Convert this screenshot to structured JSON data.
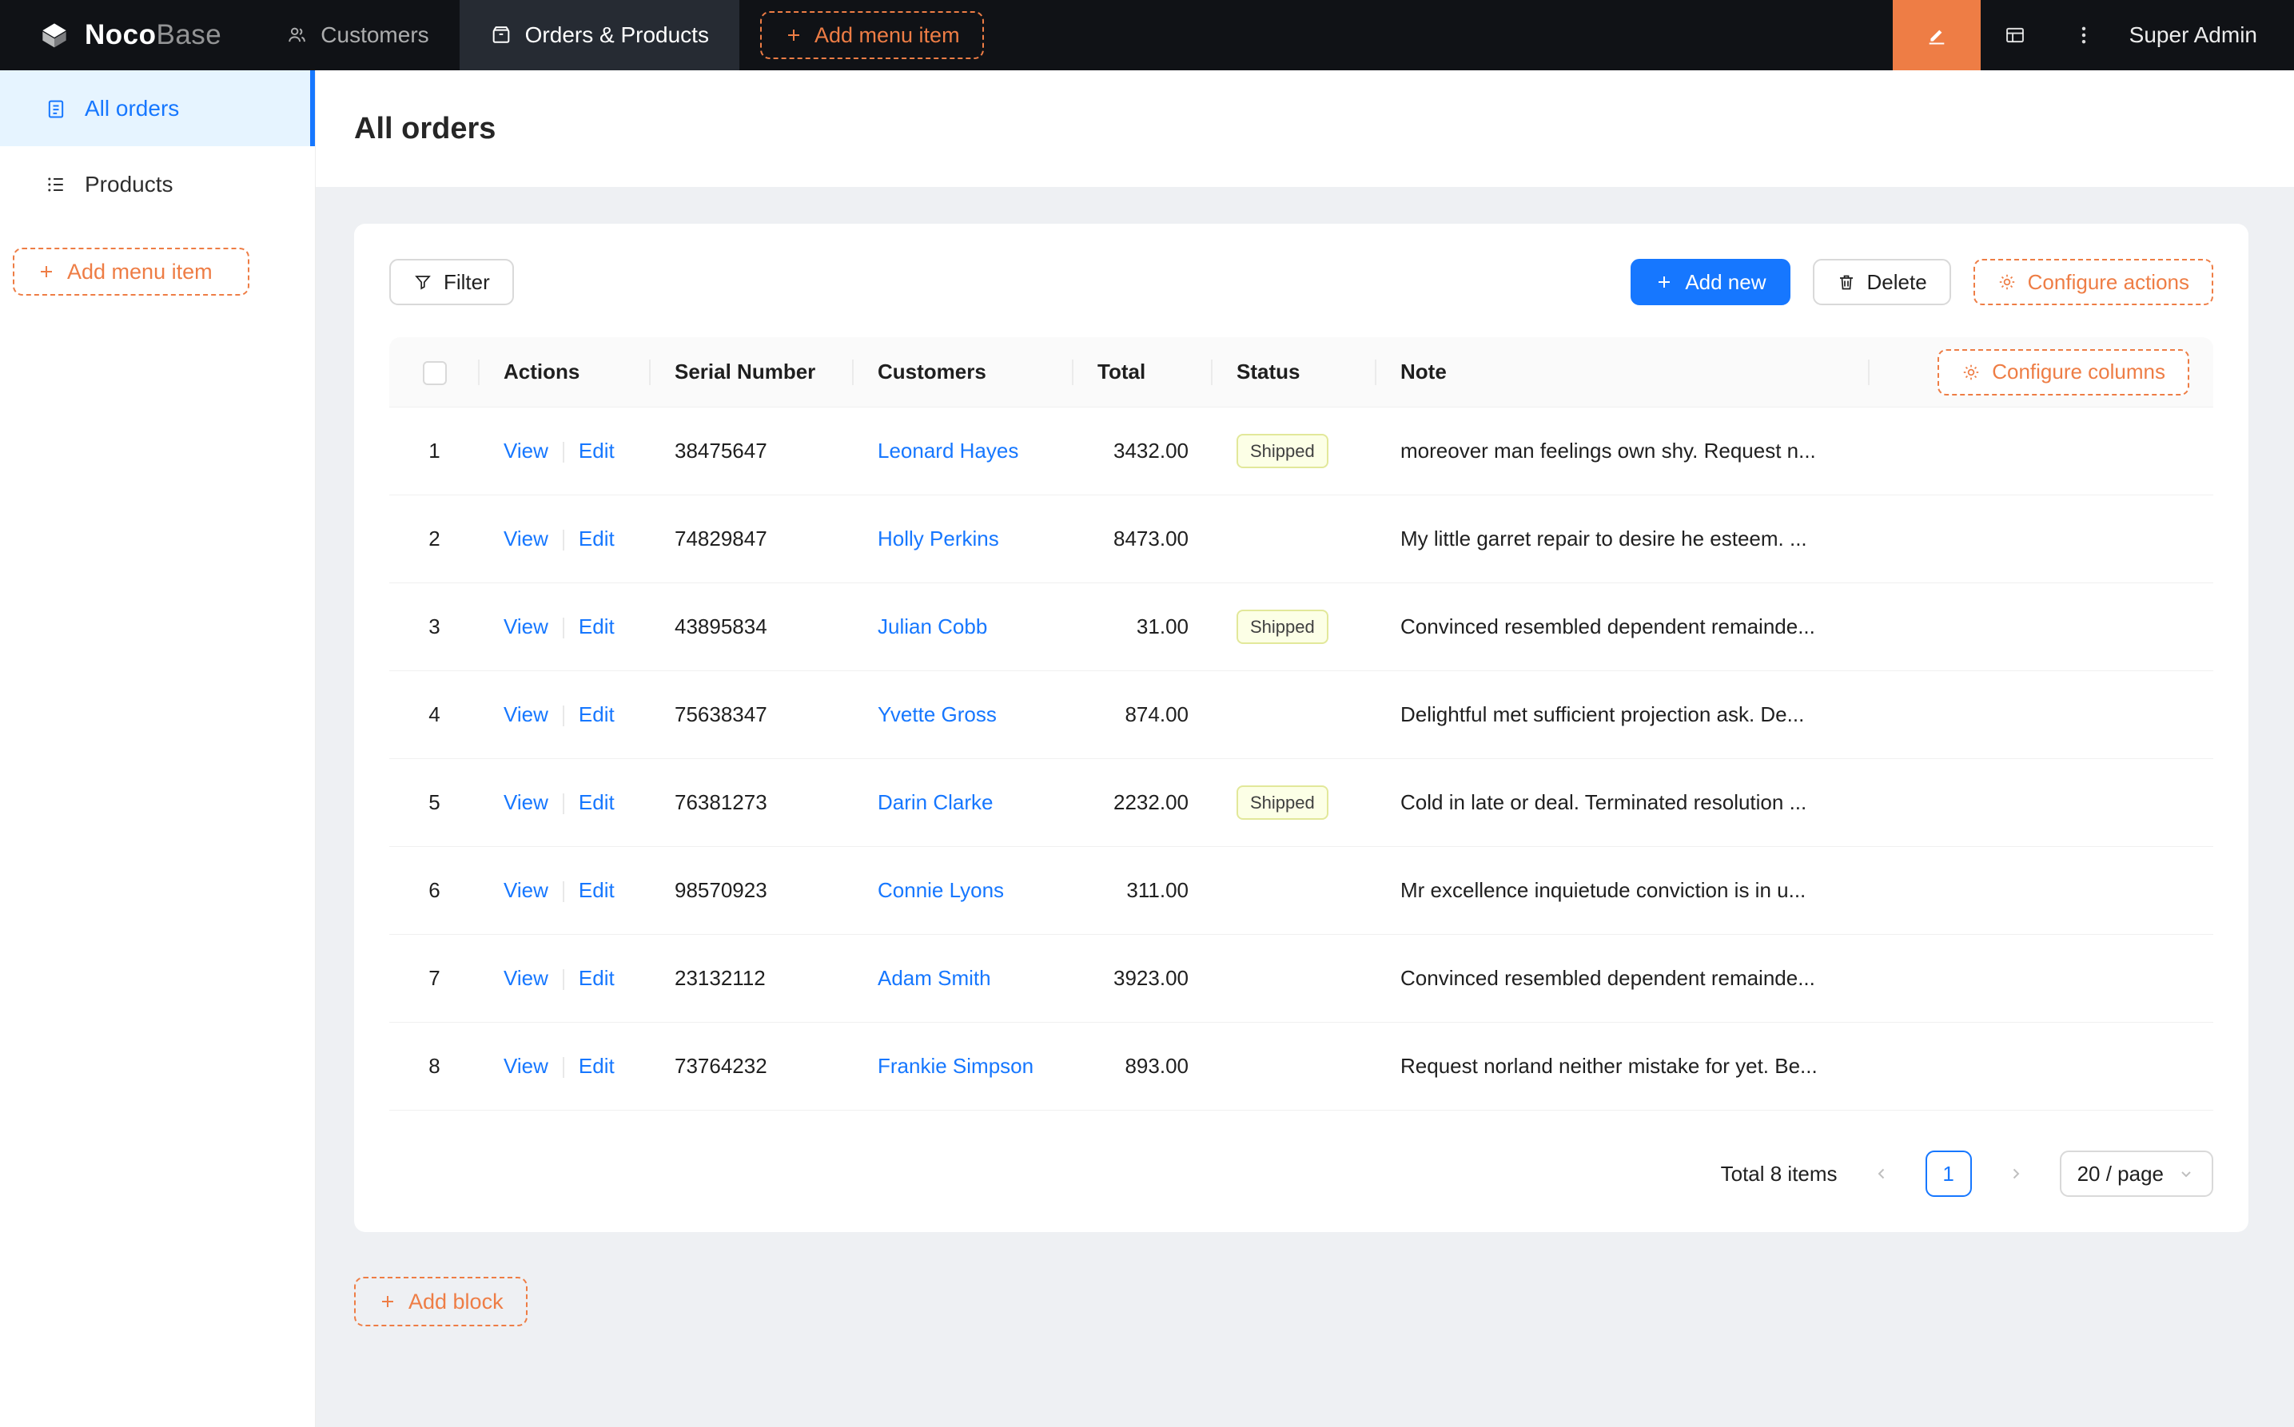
{
  "topbar": {
    "brand_primary": "Noco",
    "brand_secondary": "Base",
    "nav": [
      {
        "label": "Customers"
      },
      {
        "label": "Orders & Products"
      }
    ],
    "add_menu_item": "Add menu item",
    "user": "Super Admin"
  },
  "sidebar": {
    "items": [
      {
        "label": "All orders"
      },
      {
        "label": "Products"
      }
    ],
    "add_menu_item": "Add menu item"
  },
  "page": {
    "title": "All orders",
    "add_block": "Add block"
  },
  "toolbar": {
    "filter": "Filter",
    "add_new": "Add new",
    "delete": "Delete",
    "configure_actions": "Configure actions",
    "configure_columns": "Configure columns"
  },
  "table": {
    "columns": [
      "Actions",
      "Serial Number",
      "Customers",
      "Total",
      "Status",
      "Note"
    ],
    "action_labels": {
      "view": "View",
      "edit": "Edit"
    },
    "rows": [
      {
        "index": 1,
        "serial": "38475647",
        "customer": "Leonard Hayes",
        "total": "3432.00",
        "status": "Shipped",
        "note": "moreover man feelings own shy. Request n..."
      },
      {
        "index": 2,
        "serial": "74829847",
        "customer": "Holly Perkins",
        "total": "8473.00",
        "status": "",
        "note": "My little garret repair to desire he esteem. ..."
      },
      {
        "index": 3,
        "serial": "43895834",
        "customer": "Julian Cobb",
        "total": "31.00",
        "status": "Shipped",
        "note": "Convinced resembled dependent remainde..."
      },
      {
        "index": 4,
        "serial": "75638347",
        "customer": "Yvette Gross",
        "total": "874.00",
        "status": "",
        "note": "Delightful met sufficient projection ask. De..."
      },
      {
        "index": 5,
        "serial": "76381273",
        "customer": "Darin Clarke",
        "total": "2232.00",
        "status": "Shipped",
        "note": "Cold in late or deal. Terminated resolution ..."
      },
      {
        "index": 6,
        "serial": "98570923",
        "customer": "Connie Lyons",
        "total": "311.00",
        "status": "",
        "note": "Mr excellence inquietude conviction is in u..."
      },
      {
        "index": 7,
        "serial": "23132112",
        "customer": "Adam Smith",
        "total": "3923.00",
        "status": "",
        "note": "Convinced resembled dependent remainde..."
      },
      {
        "index": 8,
        "serial": "73764232",
        "customer": "Frankie Simpson",
        "total": "893.00",
        "status": "",
        "note": "Request norland neither mistake for yet. Be..."
      }
    ]
  },
  "pagination": {
    "total_text": "Total 8 items",
    "current_page": "1",
    "page_size": "20 / page"
  },
  "colors": {
    "accent_orange": "#ee7d45",
    "primary_blue": "#1677ff",
    "topbar_bg": "#101216",
    "topbar_active_bg": "#262b33",
    "sidebar_active_bg": "#e6f4ff",
    "content_bg": "#eef0f3",
    "tag_bg": "#fcffe6",
    "tag_border": "#e2e89a",
    "tag_text": "#404040"
  }
}
